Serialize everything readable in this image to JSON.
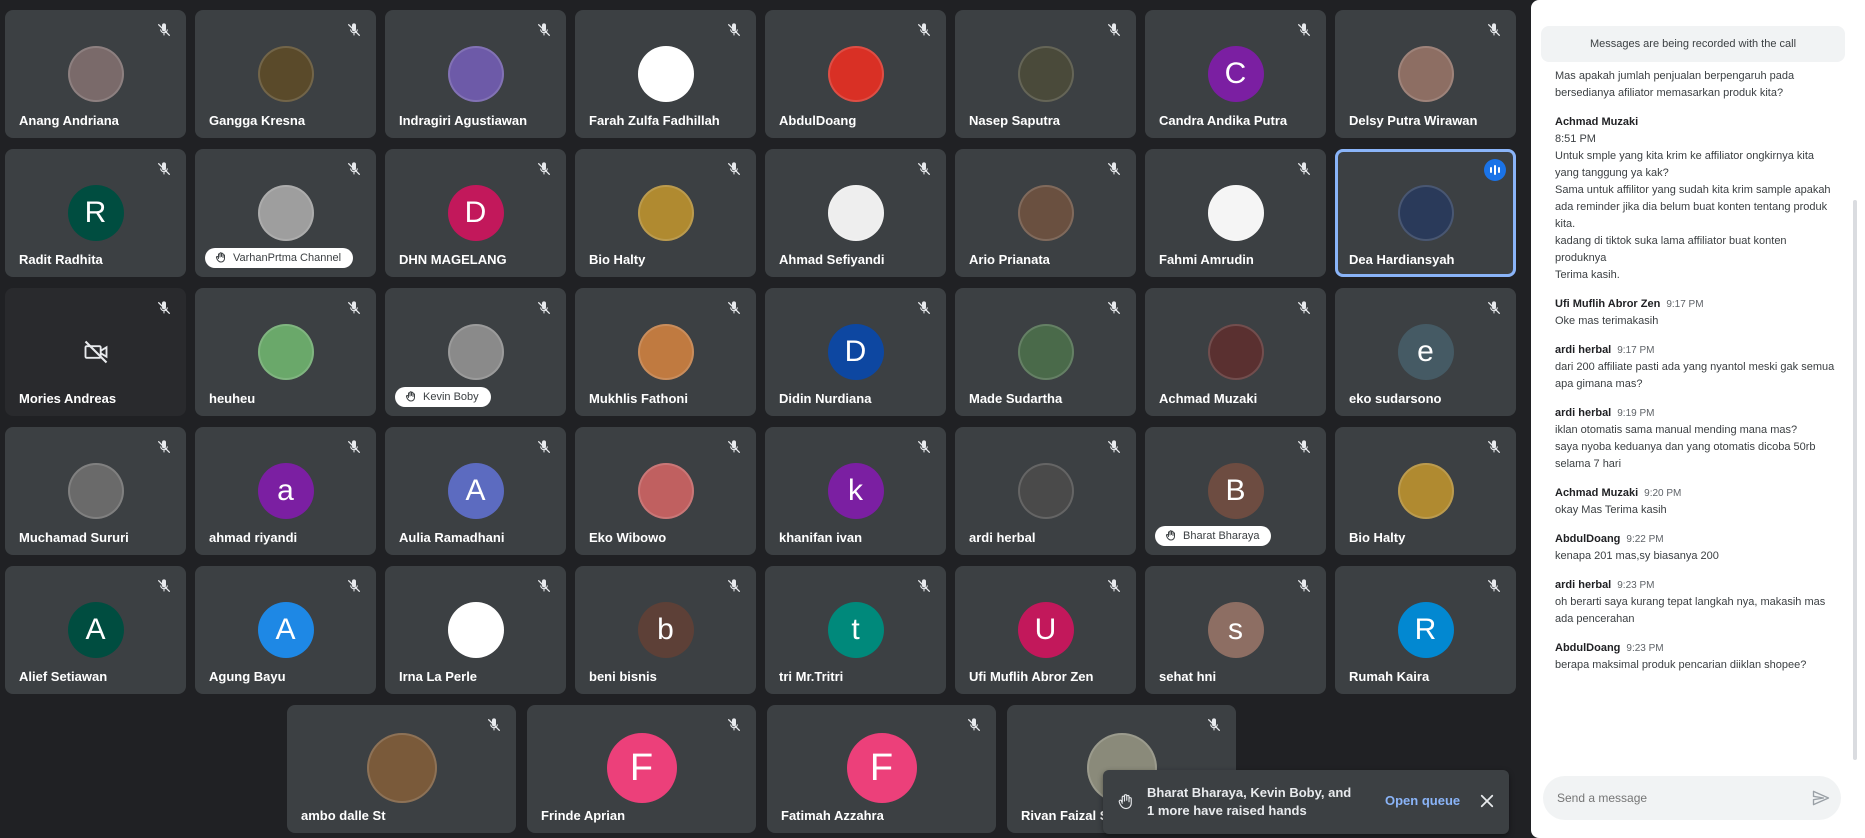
{
  "participants": [
    {
      "name": "Anang Andriana",
      "avatar": "photo",
      "color": "#7a6a6a"
    },
    {
      "name": "Gangga Kresna",
      "avatar": "photo",
      "color": "#5a4a2a"
    },
    {
      "name": "Indragiri Agustiawan",
      "avatar": "photo",
      "color": "#6d5aa8"
    },
    {
      "name": "Farah Zulfa Fadhillah",
      "avatar": "photo",
      "color": "#ffffff"
    },
    {
      "name": "AbdulDoang",
      "avatar": "photo",
      "color": "#d93025"
    },
    {
      "name": "Nasep Saputra",
      "avatar": "photo",
      "color": "#4a4a3a"
    },
    {
      "name": "Candra Andika Putra",
      "avatar": "letter",
      "letter": "C",
      "color": "#7b1fa2"
    },
    {
      "name": "Delsy Putra Wirawan",
      "avatar": "photo",
      "color": "#8d6e63"
    },
    {
      "name": "Radit Radhita",
      "avatar": "letter",
      "letter": "R",
      "color": "#004d40"
    },
    {
      "name": "",
      "avatar": "photo",
      "color": "#9e9e9e",
      "badge": "VarhanPrtma Channel"
    },
    {
      "name": "DHN MAGELANG",
      "avatar": "letter",
      "letter": "D",
      "color": "#c2185b"
    },
    {
      "name": "Bio Halty",
      "avatar": "photo",
      "color": "#b08a30"
    },
    {
      "name": "Ahmad Sefiyandi",
      "avatar": "photo",
      "color": "#eeeeee"
    },
    {
      "name": "Ario Prianata",
      "avatar": "photo",
      "color": "#6a5040"
    },
    {
      "name": "Fahmi Amrudin",
      "avatar": "photo",
      "color": "#f5f5f5"
    },
    {
      "name": "Dea Hardiansyah",
      "avatar": "photo",
      "color": "#2a3a5a",
      "speaking": true
    },
    {
      "name": "Mories Andreas",
      "avatar": "camoff",
      "color": "#292a2d"
    },
    {
      "name": "heuheu",
      "avatar": "photo",
      "color": "#6aa86a"
    },
    {
      "name": "",
      "avatar": "photo",
      "color": "#8a8a8a",
      "badge": "Kevin Boby"
    },
    {
      "name": "Mukhlis Fathoni",
      "avatar": "photo",
      "color": "#c07a40"
    },
    {
      "name": "Didin Nurdiana",
      "avatar": "letter",
      "letter": "D",
      "color": "#0d47a1"
    },
    {
      "name": "Made Sudartha",
      "avatar": "photo",
      "color": "#4a6a4a"
    },
    {
      "name": "Achmad Muzaki",
      "avatar": "photo",
      "color": "#5a3030"
    },
    {
      "name": "eko sudarsono",
      "avatar": "letter",
      "letter": "e",
      "color": "#455a64"
    },
    {
      "name": "Muchamad Sururi",
      "avatar": "photo",
      "color": "#6a6a6a"
    },
    {
      "name": "ahmad riyandi",
      "avatar": "letter",
      "letter": "a",
      "color": "#7b1fa2"
    },
    {
      "name": "Aulia Ramadhani",
      "avatar": "letter",
      "letter": "A",
      "color": "#5c6bc0"
    },
    {
      "name": "Eko Wibowo",
      "avatar": "photo",
      "color": "#c06060"
    },
    {
      "name": "khanifan ivan",
      "avatar": "letter",
      "letter": "k",
      "color": "#7b1fa2"
    },
    {
      "name": "ardi herbal",
      "avatar": "photo",
      "color": "#4a4a4a"
    },
    {
      "name": "",
      "avatar": "letter",
      "letter": "B",
      "color": "#6d4c41",
      "badge": "Bharat Bharaya"
    },
    {
      "name": "Bio Halty",
      "avatar": "photo",
      "color": "#b08a30"
    },
    {
      "name": "Alief Setiawan",
      "avatar": "letter",
      "letter": "A",
      "color": "#004d40"
    },
    {
      "name": "Agung Bayu",
      "avatar": "letter",
      "letter": "A",
      "color": "#1e88e5"
    },
    {
      "name": "Irna La Perle",
      "avatar": "photo",
      "color": "#ffffff"
    },
    {
      "name": "beni bisnis",
      "avatar": "letter",
      "letter": "b",
      "color": "#5d4037"
    },
    {
      "name": "tri Mr.Tritri",
      "avatar": "letter",
      "letter": "t",
      "color": "#00897b"
    },
    {
      "name": "Ufi Muflih Abror Zen",
      "avatar": "letter",
      "letter": "U",
      "color": "#c2185b"
    },
    {
      "name": "sehat hni",
      "avatar": "letter",
      "letter": "s",
      "color": "#8d6e63"
    },
    {
      "name": "Rumah Kaira",
      "avatar": "letter",
      "letter": "R",
      "color": "#0288d1"
    },
    {
      "name": "ambo dalle St",
      "avatar": "photo",
      "color": "#7a5a3a"
    },
    {
      "name": "Frinde Aprian",
      "avatar": "letter",
      "letter": "F",
      "color": "#ec407a"
    },
    {
      "name": "Fatimah Azzahra",
      "avatar": "letter",
      "letter": "F",
      "color": "#ec407a"
    },
    {
      "name": "Rivan Faizal Sh",
      "avatar": "photo",
      "color": "#8a8a7a"
    }
  ],
  "chat": {
    "recording_banner": "Messages are being recorded with the call",
    "messages": [
      {
        "sender": "",
        "time": "",
        "text": "Mas apakah jumlah penjualan berpengaruh pada bersedianya afiliator memasarkan produk kita?"
      },
      {
        "sender": "Achmad Muzaki",
        "time": "",
        "text": "8:51 PM\nUntuk smple yang kita krim ke affiliator ongkirnya kita yang tanggung ya kak?\nSama untuk affilitor yang sudah kita krim sample apakah ada reminder jika dia belum buat konten tentang produk kita.\nkadang di tiktok suka lama affiliator buat konten produknya\nTerima kasih."
      },
      {
        "sender": "Ufi Muflih Abror Zen",
        "time": "9:17 PM",
        "text": "Oke mas terimakasih"
      },
      {
        "sender": "ardi herbal",
        "time": "9:17 PM",
        "text": "dari 200 affiliate pasti ada yang nyantol meski gak semua apa gimana mas?"
      },
      {
        "sender": "ardi herbal",
        "time": "9:19 PM",
        "text": "iklan otomatis sama manual mending mana mas?\nsaya nyoba keduanya dan yang otomatis dicoba 50rb selama 7 hari"
      },
      {
        "sender": "Achmad Muzaki",
        "time": "9:20 PM",
        "text": "okay Mas Terima kasih"
      },
      {
        "sender": "AbdulDoang",
        "time": "9:22 PM",
        "text": "kenapa 201 mas,sy biasanya 200"
      },
      {
        "sender": "ardi herbal",
        "time": "9:23 PM",
        "text": "oh berarti saya kurang tepat langkah nya, makasih mas ada pencerahan"
      },
      {
        "sender": "AbdulDoang",
        "time": "9:23 PM",
        "text": "berapa maksimal produk pencarian diiklan shopee?"
      }
    ],
    "input_placeholder": "Send a message"
  },
  "toast": {
    "text": "Bharat Bharaya, Kevin Boby, and 1 more have raised hands",
    "action": "Open queue"
  }
}
